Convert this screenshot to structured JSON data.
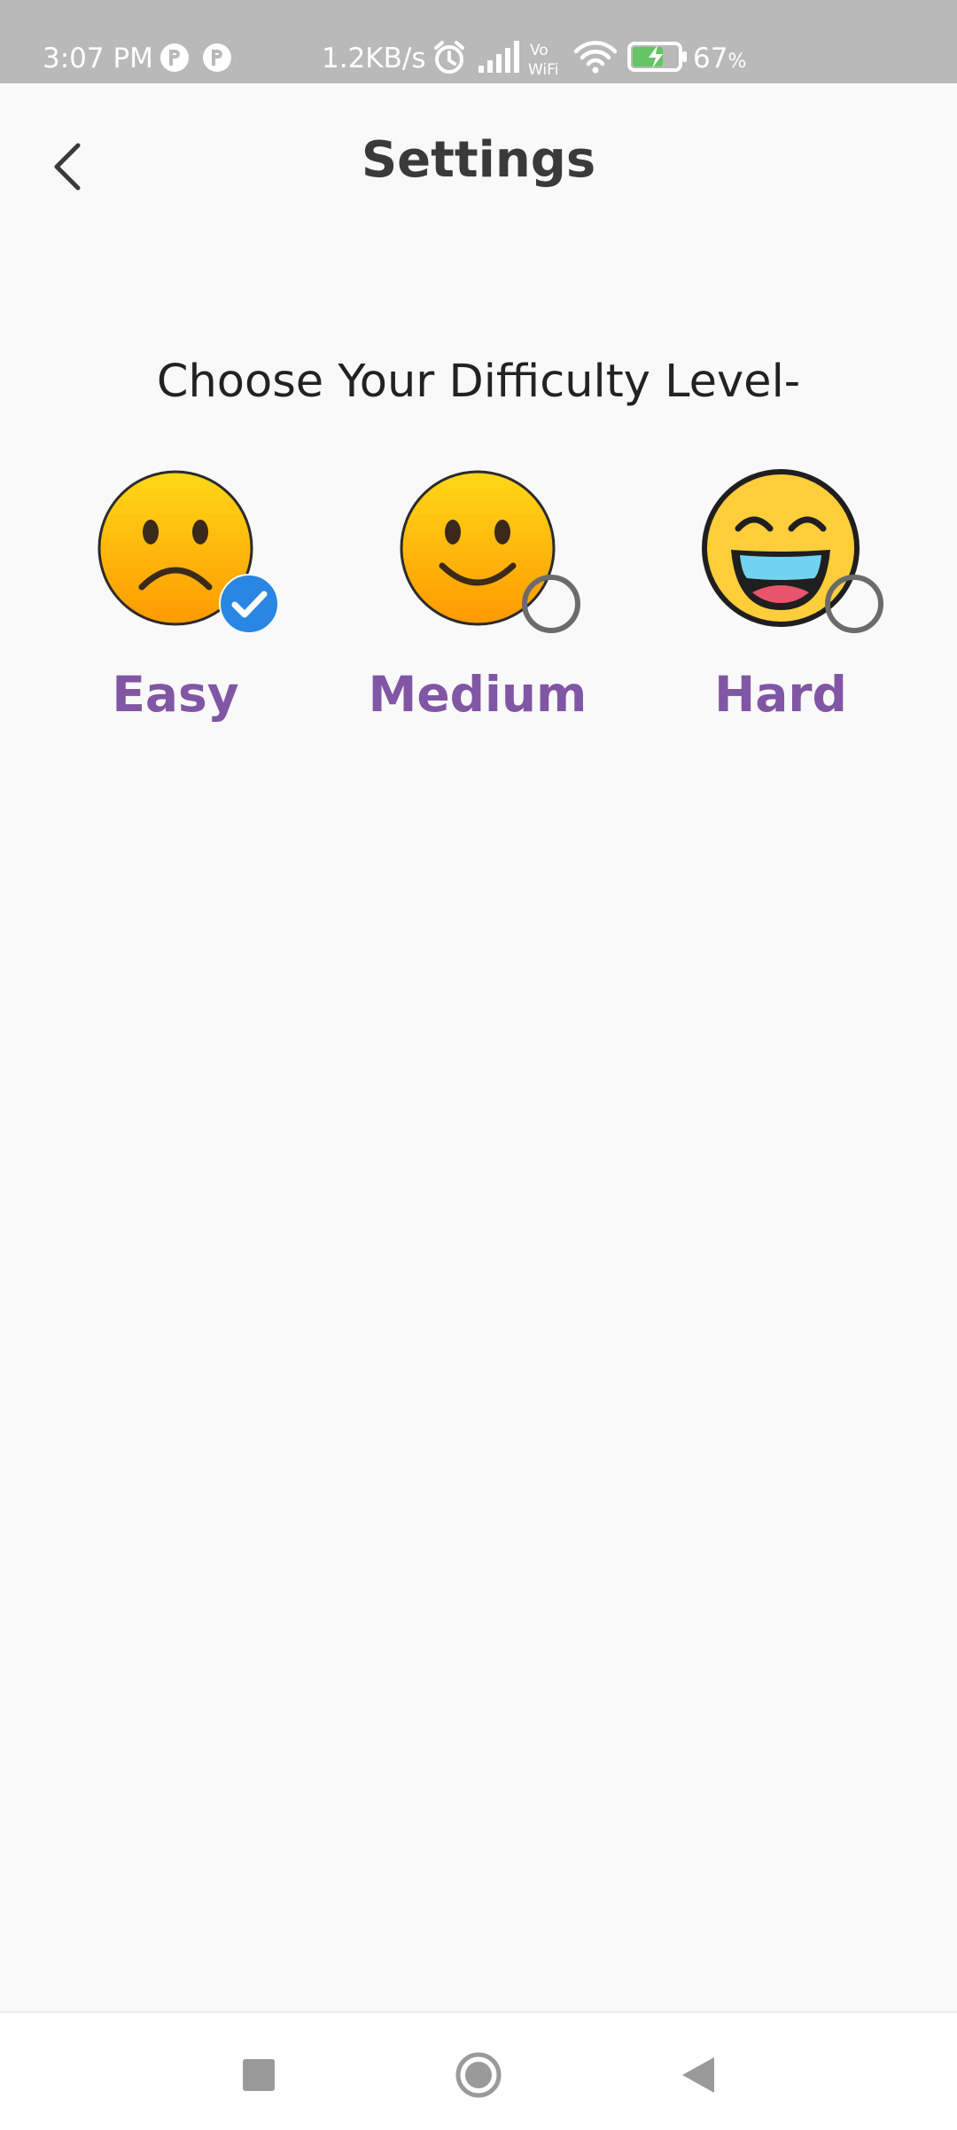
{
  "status_bar": {
    "time": "3:07 PM",
    "network_speed": "1.2KB/s",
    "battery_percent": "67",
    "battery_unit": "%",
    "icons": [
      "notification-icon",
      "notification-icon",
      "alarm-icon",
      "signal-icon",
      "vowifi-icon",
      "wifi-icon",
      "battery-charging-icon"
    ]
  },
  "header": {
    "title": "Settings",
    "back_icon": "chevron-left-icon"
  },
  "difficulty": {
    "prompt": "Choose Your Difficulty Level-",
    "selected": "Easy",
    "options": [
      {
        "label": "Easy",
        "icon": "sad-face-icon",
        "selected": true
      },
      {
        "label": "Medium",
        "icon": "smile-face-icon",
        "selected": false
      },
      {
        "label": "Hard",
        "icon": "laughing-face-icon",
        "selected": false
      }
    ]
  },
  "nav_bar": {
    "buttons": [
      "recent-apps-icon",
      "home-icon",
      "back-icon"
    ]
  },
  "colors": {
    "status_bar_bg": "#b9b9b9",
    "label_purple": "#8156a4",
    "check_blue": "#2a86e3",
    "title_dark": "#3a3a3a"
  }
}
